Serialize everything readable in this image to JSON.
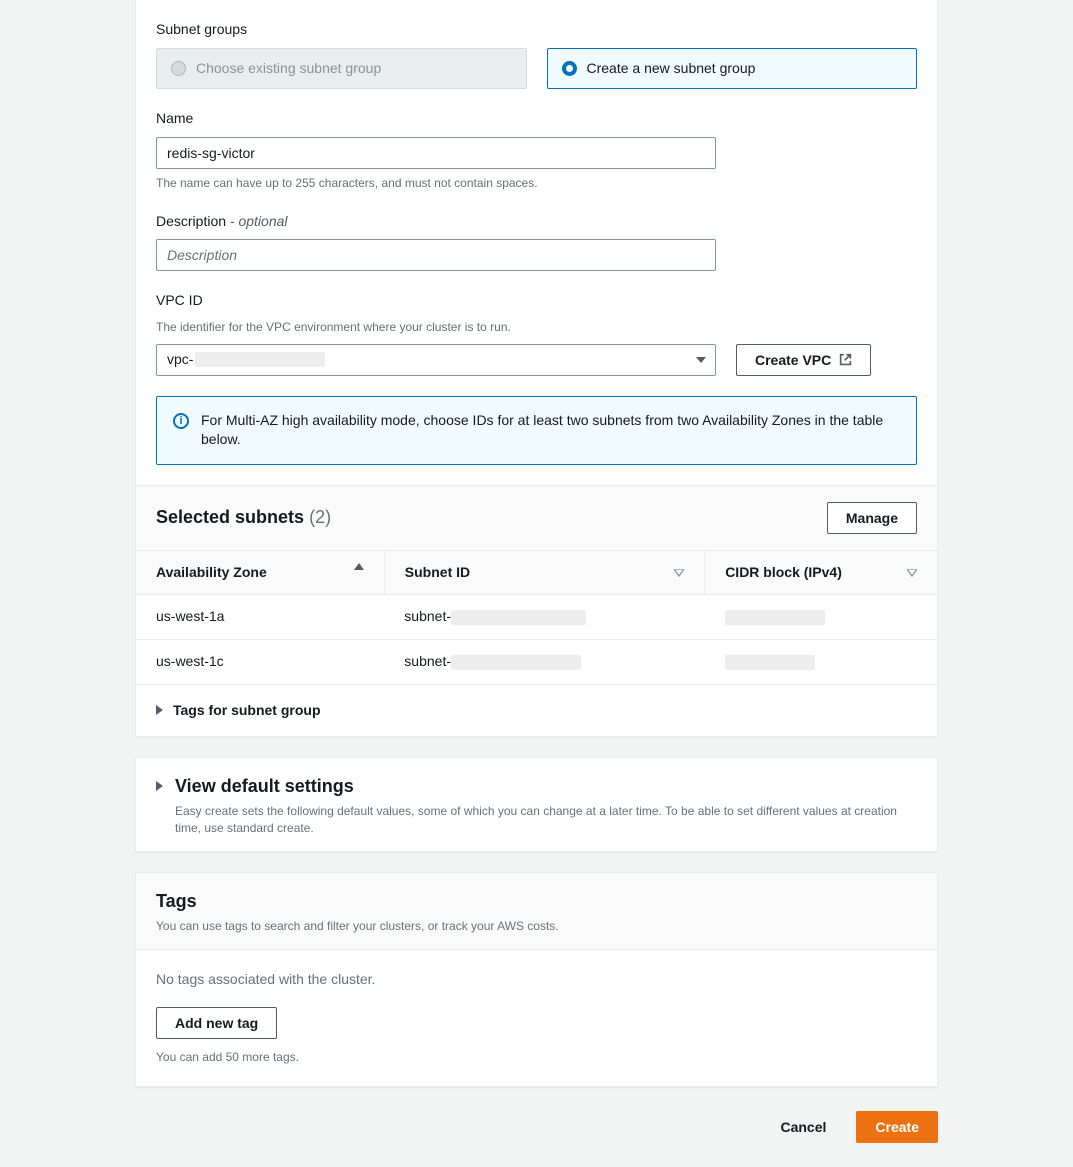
{
  "subnetGroups": {
    "label": "Subnet groups",
    "optionExisting": "Choose existing subnet group",
    "optionCreate": "Create a new subnet group"
  },
  "name": {
    "label": "Name",
    "value": "redis-sg-victor",
    "hint": "The name can have up to 255 characters, and must not contain spaces."
  },
  "description": {
    "label": "Description",
    "optional": "- optional",
    "placeholder": "Description",
    "value": ""
  },
  "vpc": {
    "label": "VPC ID",
    "hint": "The identifier for the VPC environment where your cluster is to run.",
    "valuePrefix": "vpc-",
    "createBtn": "Create VPC"
  },
  "infoAlert": "For Multi-AZ high availability mode, choose IDs for at least two subnets from two Availability Zones in the table below.",
  "selectedSubnets": {
    "title": "Selected subnets",
    "count": "(2)",
    "manageBtn": "Manage",
    "columns": {
      "az": "Availability Zone",
      "subnetId": "Subnet ID",
      "cidr": "CIDR block (IPv4)"
    },
    "rows": [
      {
        "az": "us-west-1a",
        "subnetPrefix": "subnet-"
      },
      {
        "az": "us-west-1c",
        "subnetPrefix": "subnet-"
      }
    ]
  },
  "tagsForSubnetGroup": "Tags for subnet group",
  "viewDefault": {
    "title": "View default settings",
    "desc": "Easy create sets the following default values, some of which you can change at a later time. To be able to set different values at creation time, use standard create."
  },
  "tags": {
    "title": "Tags",
    "desc": "You can use tags to search and filter your clusters, or track your AWS costs.",
    "none": "No tags associated with the cluster.",
    "addBtn": "Add new tag",
    "remaining": "You can add 50 more tags."
  },
  "footer": {
    "cancel": "Cancel",
    "create": "Create"
  }
}
